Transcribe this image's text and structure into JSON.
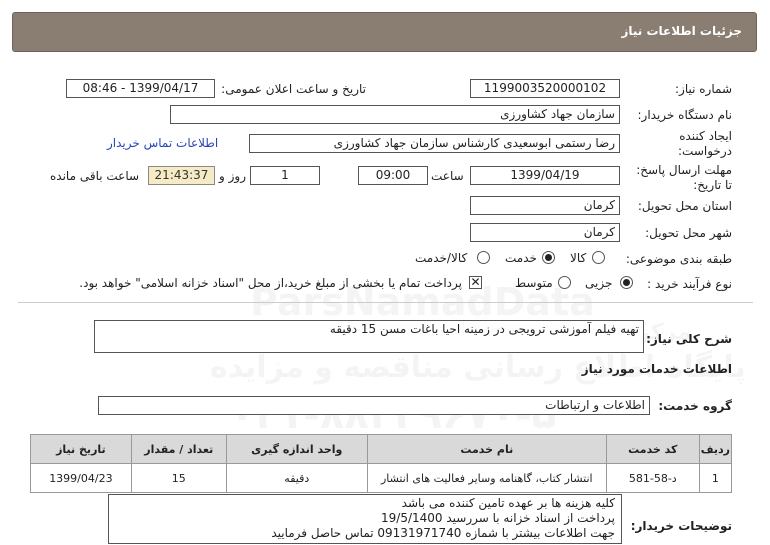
{
  "header": {
    "title": "جزئیات اطلاعات نیاز"
  },
  "fields": {
    "need_number_label": "شماره نیاز:",
    "need_number": "1199003520000102",
    "announce_label": "تاریخ و ساعت اعلان عمومی:",
    "announce_value": "1399/04/17 - 08:46",
    "buyer_org_label": "نام دستگاه خریدار:",
    "buyer_org": "سازمان جهاد کشاورزی",
    "creator_label_1": "ایجاد کننده",
    "creator_label_2": "درخواست:",
    "creator": "رضا رستمی ابوسعیدی کارشناس سازمان جهاد کشاورزی",
    "contact_link": "اطلاعات تماس خریدار",
    "deadline_label_1": "مهلت ارسال پاسخ:",
    "deadline_label_2": "تا تاریخ:",
    "deadline_date": "1399/04/19",
    "time_label": "ساعت",
    "deadline_time": "09:00",
    "days_value": "1",
    "days_label": "روز و",
    "remaining_time": "21:43:37",
    "remaining_label": "ساعت باقی مانده",
    "province_label": "استان محل تحویل:",
    "province": "کرمان",
    "city_label": "شهر محل تحویل:",
    "city": "کرمان",
    "category_label": "طبقه بندی موضوعی:",
    "category_options": [
      "کالا",
      "خدمت",
      "کالا/خدمت"
    ],
    "category_selected": "خدمت",
    "process_label": "نوع فرآیند خرید :",
    "process_options": [
      "جزیی",
      "متوسط"
    ],
    "process_selected": "جزیی",
    "payment_note": "پرداخت تمام یا بخشی از مبلغ خرید،از محل \"اسناد خزانه اسلامی\" خواهد بود.",
    "payment_checked": true
  },
  "summary": {
    "label": "شرح کلی نیاز:",
    "text": "تهیه فیلم آموزشی ترویجی در زمینه احیا باغات مسن 15 دقیقه"
  },
  "services_section": {
    "title": "اطلاعات خدمات مورد نیاز",
    "group_label": "گروه خدمت:",
    "group_value": "اطلاعات و ارتباطات"
  },
  "table": {
    "headers": [
      "ردیف",
      "کد خدمت",
      "نام خدمت",
      "واحد اندازه گیری",
      "تعداد / مقدار",
      "تاریخ نیاز"
    ],
    "rows": [
      [
        "1",
        "د-58-581",
        "انتشار کتاب، گاهنامه وسایر فعالیت های انتشار",
        "دقیقه",
        "15",
        "1399/04/23"
      ]
    ]
  },
  "buyer_notes": {
    "label": "توضیحات خریدار:",
    "lines": [
      "کلیه هزینه ها بر عهده تامین کننده می باشد",
      "پرداخت از اسناد خزانه با سررسید 19/5/1400",
      "جهت اطلاعات بیشتر با شمازه 09131971740 تماس حاصل فرمایید"
    ]
  },
  "watermark": {
    "brand": "ParsNamadData",
    "phone": "۰۲۱-۸۸۳۴۹۶۷۰-۵",
    "line1": "پایگاه اطلاع رسانی مناقصه و مزایده",
    "line2": "مرکز فراوری اطلاعات پارس نماد داده ها"
  },
  "colors": {
    "header_bg": "#8a7d72",
    "timer_bg": "#f5ecc6",
    "link": "#2845b8",
    "table_header_bg": "#d9d9d9"
  }
}
